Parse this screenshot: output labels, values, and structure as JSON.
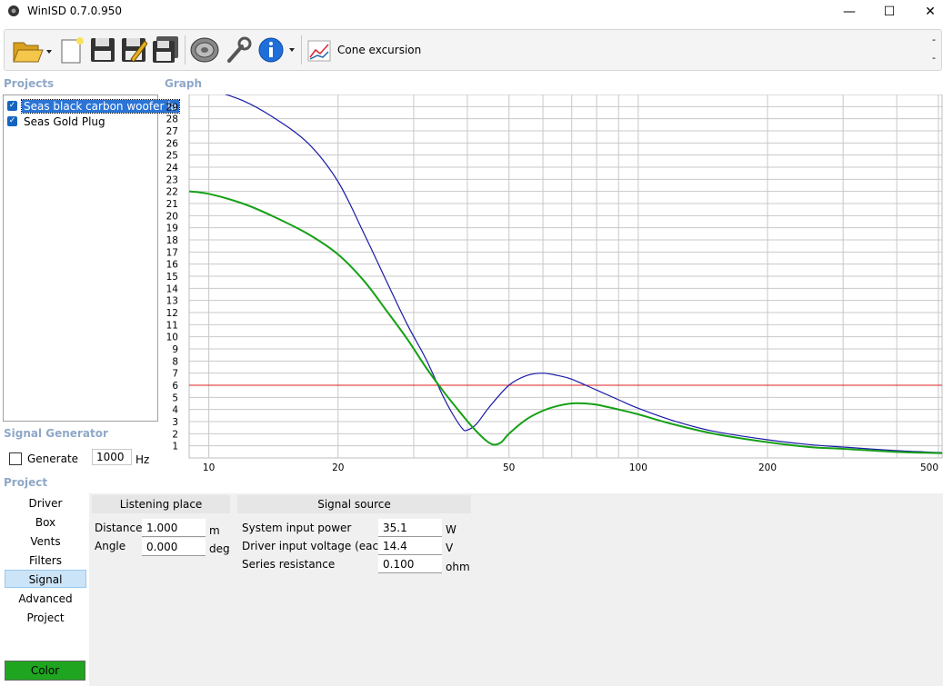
{
  "window": {
    "title": "WinISD 0.7.0.950",
    "minimize": "—",
    "maximize": "☐",
    "close": "✕"
  },
  "toolbar": {
    "buttons": [
      {
        "icon": "open-folder-icon"
      },
      {
        "icon": "new-document-icon"
      },
      {
        "icon": "save-icon"
      },
      {
        "icon": "save-as-icon"
      },
      {
        "icon": "save-all-icon"
      },
      {
        "icon": "speaker-driver-icon"
      },
      {
        "icon": "wrench-icon"
      },
      {
        "icon": "info-icon"
      }
    ],
    "graph_type_label": "Cone excursion",
    "right_dash_1": "-",
    "right_dash_2": "-"
  },
  "projects": {
    "label": "Projects",
    "items": [
      {
        "label": "Seas black carbon woofer la",
        "checked": true,
        "selected": true
      },
      {
        "label": "Seas Gold Plug",
        "checked": true,
        "selected": false
      }
    ]
  },
  "graph": {
    "label": "Graph"
  },
  "signal_generator": {
    "label": "Signal Generator",
    "generate_label": "Generate",
    "frequency": "1000",
    "frequency_unit": "Hz"
  },
  "project_nav": {
    "label": "Project",
    "items": [
      "Driver",
      "Box",
      "Vents",
      "Filters",
      "Signal",
      "Advanced",
      "Project"
    ],
    "selected": "Signal",
    "color_button": "Color"
  },
  "listening_place": {
    "header": "Listening place",
    "distance_label": "Distance",
    "distance_value": "1.000",
    "distance_unit": "m",
    "angle_label": "Angle",
    "angle_value": "0.000",
    "angle_unit": "deg"
  },
  "signal_source": {
    "header": "Signal source",
    "power_label": "System input power",
    "power_value": "35.1",
    "power_unit": "W",
    "voltage_label": "Driver input voltage (each)",
    "voltage_value": "14.4",
    "voltage_unit": "V",
    "resistance_label": "Series resistance",
    "resistance_value": "0.100",
    "resistance_unit": "ohm"
  },
  "colors": {
    "series_blue": "#1a1aa8",
    "series_green": "#16a016",
    "limit_red": "#e02020",
    "grid": "#c8c8c8"
  },
  "chart_data": {
    "type": "line",
    "x_scale": "log",
    "xlim": [
      9,
      510
    ],
    "ylim": [
      0,
      30
    ],
    "x_tick_labels": [
      "10",
      "20",
      "50",
      "100",
      "200",
      "500"
    ],
    "y_tick_labels": [
      "1",
      "2",
      "3",
      "4",
      "5",
      "6",
      "7",
      "8",
      "9",
      "10",
      "11",
      "12",
      "13",
      "14",
      "15",
      "16",
      "17",
      "18",
      "19",
      "20",
      "21",
      "22",
      "23",
      "24",
      "25",
      "26",
      "27",
      "28",
      "29"
    ],
    "grid": true,
    "limit_line": 6,
    "series": [
      {
        "color": "#1a1aa8",
        "x": [
          9,
          10,
          12,
          14,
          17,
          20,
          23,
          26,
          29,
          32,
          35,
          37,
          39,
          40,
          42,
          45,
          50,
          55,
          60,
          65,
          70,
          80,
          90,
          100,
          120,
          150,
          200,
          250,
          300,
          400,
          500,
          510
        ],
        "y": [
          31.5,
          30.5,
          29.5,
          28.2,
          26.0,
          22.8,
          18.5,
          14.5,
          11.0,
          8.2,
          5.2,
          3.6,
          2.4,
          2.3,
          2.8,
          4.2,
          6.0,
          6.8,
          7.0,
          6.8,
          6.5,
          5.6,
          4.8,
          4.1,
          3.1,
          2.2,
          1.5,
          1.1,
          0.9,
          0.6,
          0.45,
          0.4
        ]
      },
      {
        "color": "#16a016",
        "x": [
          9,
          10,
          12,
          14,
          17,
          20,
          23,
          26,
          29,
          32,
          35,
          38,
          41,
          44,
          46,
          48,
          50,
          55,
          60,
          65,
          70,
          75,
          80,
          90,
          100,
          120,
          150,
          200,
          250,
          300,
          400,
          500,
          510
        ],
        "y": [
          22.0,
          21.8,
          21.0,
          20.0,
          18.5,
          16.8,
          14.6,
          12.1,
          9.8,
          7.5,
          5.6,
          4.0,
          2.6,
          1.5,
          1.1,
          1.3,
          2.0,
          3.2,
          3.9,
          4.3,
          4.5,
          4.5,
          4.4,
          4.0,
          3.6,
          2.8,
          2.0,
          1.3,
          0.9,
          0.75,
          0.5,
          0.4,
          0.38
        ]
      }
    ]
  }
}
